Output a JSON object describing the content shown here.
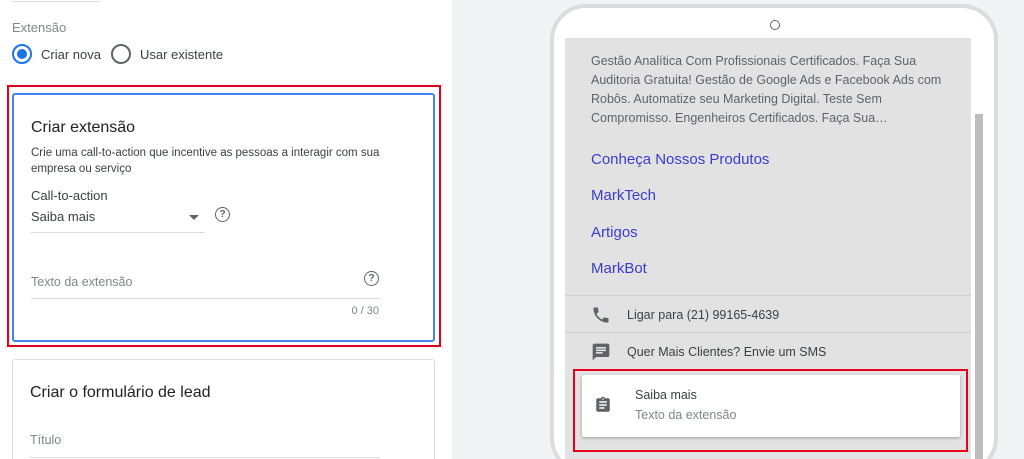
{
  "form": {
    "extension_label": "Extensão",
    "radio_options": [
      {
        "label": "Criar nova",
        "selected": true
      },
      {
        "label": "Usar existente",
        "selected": false
      }
    ],
    "create_card": {
      "title": "Criar extensão",
      "description": "Crie uma call-to-action que incentive as pessoas a interagir com sua empresa ou serviço",
      "cta_label": "Call-to-action",
      "cta_value": "Saiba mais",
      "help_glyph": "?",
      "text_placeholder": "Texto da extensão",
      "counter": "0 / 30"
    },
    "lead_card": {
      "title": "Criar o formulário de lead",
      "field_placeholder": "Título"
    }
  },
  "preview": {
    "description": "Gestão Analítica Com Profissionais Certificados. Faça Sua Auditoria Gratuita! Gestão de Google Ads e Facebook Ads com Robôs. Automatize seu Marketing Digital. Teste Sem Compromisso. Engenheiros Certificados. Faça Sua…",
    "sitelinks": [
      "Conheça Nossos Produtos",
      "MarkTech",
      "Artigos",
      "MarkBot"
    ],
    "call_label": "Ligar para (21) 99165-4639",
    "sms_label": "Quer Mais Clientes? Envie um SMS",
    "cta_card": {
      "title": "Saiba mais",
      "subtitle": "Texto da extensão"
    },
    "icons": {
      "call": "phone-icon",
      "sms": "message-icon",
      "cta": "clipboard-icon"
    }
  },
  "colors": {
    "accent": "#1a73e8",
    "highlight_red": "#e6001a",
    "link": "#3c3ccc"
  }
}
